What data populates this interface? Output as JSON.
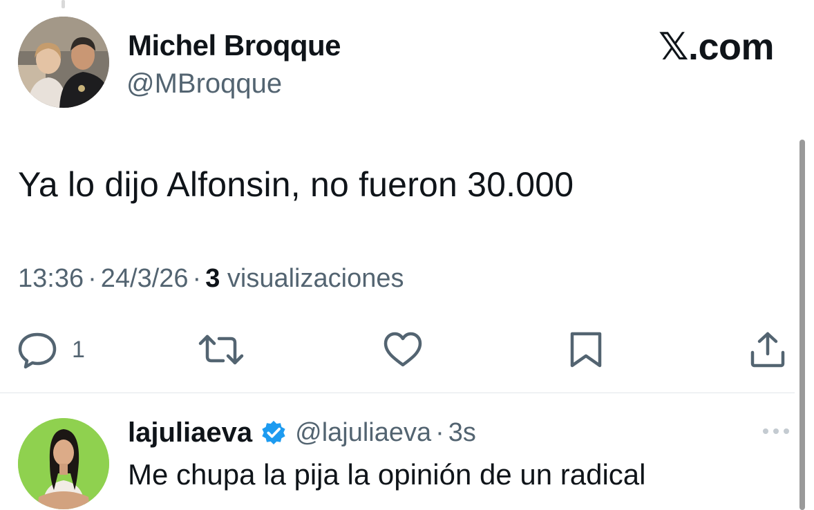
{
  "tweet": {
    "author_name": "Michel Broqque",
    "author_handle": "@MBroqque",
    "source_logo_glyph": "𝕏",
    "source_logo_text": ".com",
    "text": "Ya lo dijo Alfonsin, no fueron 30.000",
    "time": "13:36",
    "date": "24/3/26",
    "separator": "·",
    "views_count": "3",
    "views_label": "visualizaciones"
  },
  "actions": {
    "reply_icon": "reply-icon",
    "reply_count": "1",
    "retweet_icon": "retweet-icon",
    "like_icon": "heart-icon",
    "bookmark_icon": "bookmark-icon",
    "share_icon": "share-icon"
  },
  "reply": {
    "author_name": "lajuliaeva",
    "verified_icon": "verified-badge-icon",
    "author_handle": "@lajuliaeva",
    "separator": "·",
    "time": "3s",
    "text": "Me chupa la pija la opinión de un radical",
    "more_icon": "more-options-icon"
  },
  "colors": {
    "text_primary": "#0f1419",
    "text_secondary": "#536471",
    "verified_blue": "#1d9bf0",
    "divider": "#e1e6ea",
    "reply_avatar_bg": "#8fd14f"
  }
}
